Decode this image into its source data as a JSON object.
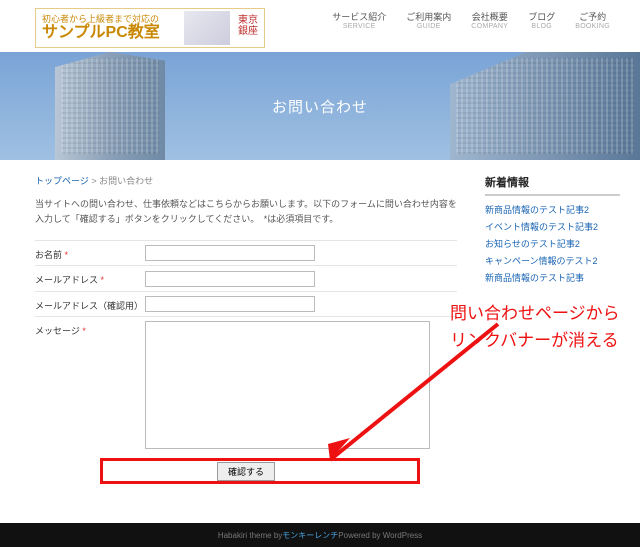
{
  "brand": {
    "tagline": "初心者から上級者まで対応の",
    "name": "サンプルPC教室",
    "location": "東京\n銀座"
  },
  "nav": [
    {
      "jp": "サービス紹介",
      "en": "SERVICE"
    },
    {
      "jp": "ご利用案内",
      "en": "GUIDE"
    },
    {
      "jp": "会社概要",
      "en": "COMPANY"
    },
    {
      "jp": "ブログ",
      "en": "BLOG"
    },
    {
      "jp": "ご予約",
      "en": "BOOKING"
    }
  ],
  "hero": {
    "title": "お問い合わせ"
  },
  "breadcrumb": {
    "home": "トップページ",
    "sep": ">",
    "current": "お問い合わせ"
  },
  "lead": "当サイトへの問い合わせ、仕事依頼などはこちらからお願いします。以下のフォームに問い合わせ内容を入力して「確認する」ボタンをクリックしてください。　*は必須項目です。",
  "form": {
    "name_label": "お名前",
    "email_label": "メールアドレス",
    "email2_label": "メールアドレス（確認用）",
    "message_label": "メッセージ",
    "req": "*",
    "submit": "確認する"
  },
  "sidebar": {
    "heading": "新着情報",
    "items": [
      "新商品情報のテスト記事2",
      "イベント情報のテスト記事2",
      "お知らせのテスト記事2",
      "キャンペーン情報のテスト2",
      "新商品情報のテスト記事"
    ]
  },
  "footer": {
    "t1": "Habakiri theme by ",
    "link": "モンキーレンチ",
    "t2": " Powered by WordPress"
  },
  "annotation": {
    "text": "問い合わせページからリンクバナーが消える"
  }
}
